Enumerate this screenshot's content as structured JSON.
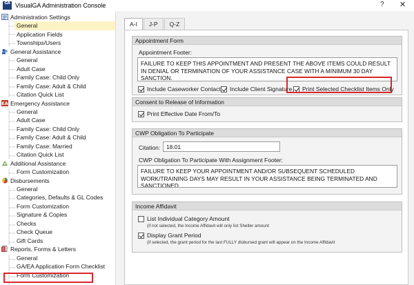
{
  "window": {
    "title": "VisualGA Administration Console",
    "icon_text": "GA",
    "help_symbol": "?",
    "close_symbol": "✕"
  },
  "sidebar": {
    "groups": [
      {
        "label": "Administration Settings",
        "icon": "settings-icon",
        "items": [
          "General",
          "Application Fields",
          "Townships/Users"
        ]
      },
      {
        "label": "General Assistance",
        "icon": "ga-icon",
        "items": [
          "General",
          "Adult Case",
          "Family Case: Child Only",
          "Family Case: Adult & Child",
          "Citation Quick List"
        ]
      },
      {
        "label": "Emergency Assistance",
        "icon": "ea-icon",
        "items": [
          "General",
          "Adult Case",
          "Family Case: Child Only",
          "Family Case: Adult & Child",
          "Family Case: Married",
          "Citation Quick List"
        ]
      },
      {
        "label": "Additional Assistance",
        "icon": "additional-assistance-icon",
        "items": [
          "Form Customization"
        ]
      },
      {
        "label": "Disbursements",
        "icon": "disbursements-icon",
        "items": [
          "General",
          "Categories, Defaults & GL Codes",
          "Form Customization",
          "Signature & Copies",
          "Checks",
          "Check Queue",
          "Gift Cards"
        ]
      },
      {
        "label": "Reports, Forms & Letters",
        "icon": "reports-icon",
        "items": [
          "General",
          "GA/EA Application Form Checklist",
          "Form Customization"
        ]
      }
    ],
    "selected": "Administration Settings / General"
  },
  "tabs": [
    "A-I",
    "J-P",
    "Q-Z"
  ],
  "active_tab": "A-I",
  "appointment_form": {
    "title": "Appointment Form",
    "footer_label": "Appointment Footer:",
    "footer_text": "FAILURE TO KEEP THIS APPOINTMENT AND PRESENT THE ABOVE ITEMS COULD RESULT IN DENIAL OR TERMINATION OF YOUR ASSISTANCE CASE WITH A MINIMUM 30 DAY SANCTION.",
    "checkboxes": [
      {
        "label": "Include Caseworker Contact",
        "checked": true
      },
      {
        "label": "Include Client Signature",
        "checked": true
      },
      {
        "label": "Print Selected Checklist Items Only",
        "checked": true
      }
    ]
  },
  "consent": {
    "title": "Consent to Release of Information",
    "checkbox": {
      "label": "Print Effective Date From/To",
      "checked": true
    }
  },
  "cwp": {
    "title": "CWP Obligation To Participate",
    "citation_label": "Citation:",
    "citation_value": "18.01",
    "footer_label": "CWP Obligation To Participate With Assignment Footer:",
    "footer_text": "FAILURE TO KEEP YOUR APPOINTMENT AND/OR SUBSEQUENT SCHEDULED WORK/TRAINING DAYS MAY RESULT IN YOUR ASSISTANCE BEING TERMINATED AND SANCTIONED"
  },
  "income_affidavit": {
    "title": "Income Affidavit",
    "checkboxes": [
      {
        "label": "List Individual Category Amount",
        "checked": false,
        "note": "(if not selected, the Income Affidavit will only list Shelter amount"
      },
      {
        "label": "Display Grant Period",
        "checked": true,
        "note": "(if selected, the grant period for the last FULLY disbursed grant will appear on the Income Affidavit"
      }
    ]
  },
  "colors": {
    "highlight": "#d9262c",
    "selection": "#fdf3c5",
    "group_header": "#dcdcdc"
  }
}
